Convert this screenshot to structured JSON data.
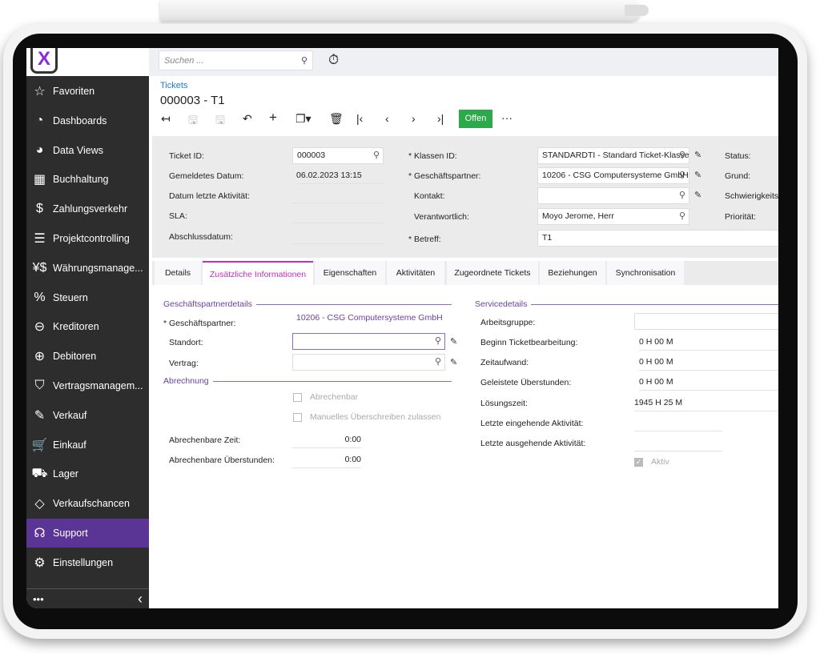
{
  "search": {
    "placeholder": "Suchen ..."
  },
  "sidebar": {
    "items": [
      {
        "label": "Favoriten",
        "icon": "star-icon"
      },
      {
        "label": "Dashboards",
        "icon": "gauge-icon"
      },
      {
        "label": "Data Views",
        "icon": "pie-chart-icon"
      },
      {
        "label": "Buchhaltung",
        "icon": "calculator-icon"
      },
      {
        "label": "Zahlungsverkehr",
        "icon": "dollar-icon"
      },
      {
        "label": "Projektcontrolling",
        "icon": "gantt-icon"
      },
      {
        "label": "Währungsmanage...",
        "icon": "currency-icon"
      },
      {
        "label": "Steuern",
        "icon": "percent-icon"
      },
      {
        "label": "Kreditoren",
        "icon": "minus-circle-icon"
      },
      {
        "label": "Debitoren",
        "icon": "plus-circle-icon"
      },
      {
        "label": "Vertragsmanagem...",
        "icon": "handshake-icon"
      },
      {
        "label": "Verkauf",
        "icon": "edit-icon"
      },
      {
        "label": "Einkauf",
        "icon": "cart-icon"
      },
      {
        "label": "Lager",
        "icon": "truck-icon"
      },
      {
        "label": "Verkaufschancen",
        "icon": "tag-icon"
      },
      {
        "label": "Support",
        "icon": "headset-icon",
        "active": true
      },
      {
        "label": "Einstellungen",
        "icon": "gear-icon"
      }
    ],
    "more": "•••",
    "collapse": "‹"
  },
  "header": {
    "breadcrumb": "Tickets",
    "title": "000003 - T1",
    "status_button": "Offen",
    "more": "···",
    "accent": "#5b3595",
    "status_color": "#2ca94b"
  },
  "form": {
    "ticket_id": {
      "label": "Ticket ID:",
      "value": "000003"
    },
    "gemeldet": {
      "label": "Gemeldetes Datum:",
      "value": "06.02.2023 13:15"
    },
    "letzte_aktivitaet": {
      "label": "Datum letzte Aktivität:"
    },
    "sla": {
      "label": "SLA:"
    },
    "abschluss": {
      "label": "Abschlussdatum:"
    },
    "klassen_id": {
      "label": "* Klassen ID:",
      "value": "STANDARDTI - Standard Ticket-Klasse"
    },
    "partner": {
      "label": "* Geschäftspartner:",
      "value": "10206 - CSG Computersysteme GmbH"
    },
    "kontakt": {
      "label": "Kontakt:",
      "value": ""
    },
    "verantwortlich": {
      "label": "Verantwortlich:",
      "value": "Moyo Jerome, Herr"
    },
    "betreff": {
      "label": "* Betreff:",
      "value": "T1"
    },
    "status": {
      "label": "Status:"
    },
    "grund": {
      "label": "Grund:"
    },
    "schwierigkeit": {
      "label": "Schwierigkeitsg"
    },
    "prioritaet": {
      "label": "Priorität:"
    }
  },
  "tabs": [
    "Details",
    "Zusätzliche Informationen",
    "Eigenschaften",
    "Aktivitäten",
    "Zugeordnete Tickets",
    "Beziehungen",
    "Synchronisation"
  ],
  "partnerdetails": {
    "title": "Geschäftspartnerdetails",
    "partner_label": "* Geschäftspartner:",
    "partner_value": "10206 - CSG Computersysteme GmbH",
    "standort_label": "Standort:",
    "vertrag_label": "Vertrag:"
  },
  "abrechnung": {
    "title": "Abrechnung",
    "abrechenbar": "Abrechenbar",
    "manuell": "Manuelles Überschreiben zulassen",
    "zeit_label": "Abrechenbare Zeit:",
    "zeit_value": "0:00",
    "ueber_label": "Abrechenbare Überstunden:",
    "ueber_value": "0:00"
  },
  "service": {
    "title": "Servicedetails",
    "arbeitsgruppe": "Arbeitsgruppe:",
    "beginn_label": "Beginn Ticketbearbeitung:",
    "beginn_value": "0 H 00 M",
    "zeit_label": "Zeitaufwand:",
    "zeit_value": "0 H 00 M",
    "ueber_label": "Geleistete Überstunden:",
    "ueber_value": "0 H 00 M",
    "loesung_label": "Lösungszeit:",
    "loesung_value": "1945 H 25 M",
    "eingehend": "Letzte eingehende Aktivität:",
    "ausgehend": "Letzte ausgehende Aktivität:",
    "aktiv": "Aktiv",
    "aktiv_checked": true
  }
}
